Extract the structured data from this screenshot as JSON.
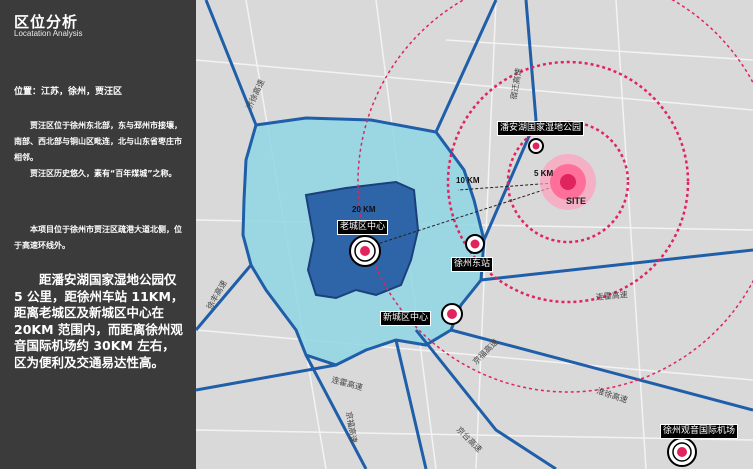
{
  "panel": {
    "title": "区位分析",
    "subtitle": "Locatation Analysis",
    "location": "位置：江苏，徐州，贾汪区",
    "para1": "贾汪区位于徐州东北部，东与邳州市接壤，南部、西北部与铜山区毗连，北与山东省枣庄市相邻。",
    "para2": "贾汪区历史悠久，素有“百年煤城”之称。",
    "para3": "本项目位于徐州市贾汪区疏港大道北侧，位于高速环线外。",
    "summary": "距潘安湖国家湿地公园仅 5 公里，距徐州车站 11KM，距离老城区及新城区中心在 20KM 范围内，而距离徐州观音国际机场约 30KM 左右，区为便利及交通易达性高。"
  },
  "map": {
    "labels": {
      "panan": "潘安湖国家湿地公园",
      "old_city": "老城区中心",
      "station": "徐州东站",
      "new_city": "新城区中心",
      "airport": "徐州观音国际机场",
      "site": "SITE",
      "d20": "20 KM",
      "d10": "10 KM",
      "d5": "5 KM"
    },
    "roads": {
      "r1": "济徐高速",
      "r2": "连霍高速",
      "r3": "连霍高速",
      "r4": "京福高速",
      "r5": "淮徐高速",
      "r6": "宿迁高速",
      "r7": "徐丰高速",
      "r8": "京福高速",
      "r9": "京台高速"
    },
    "colors": {
      "outer_zone": "#8fd6e3",
      "old_city_zone": "#2e64a8",
      "rings": "#e0245e",
      "site": "#ff2f6e"
    }
  }
}
